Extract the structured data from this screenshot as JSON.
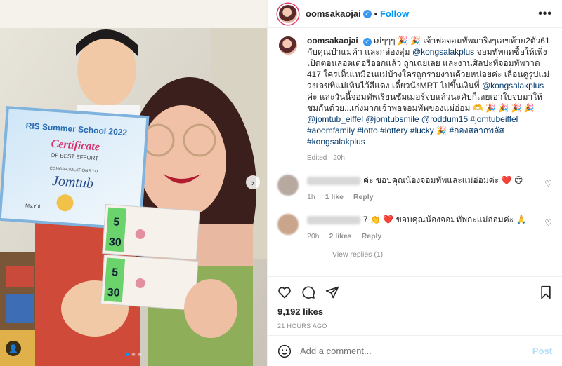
{
  "post": {
    "username": "oomsakaojai",
    "follow_label": "Follow",
    "separator": "•",
    "more_label": "•••"
  },
  "media": {
    "certificate_title": "RIS Summer School 2022",
    "certificate_heading": "Certificate",
    "certificate_sub": "OF BEST EFFORT",
    "congrats": "CONGRATULATIONS TO",
    "recipient": "Jomtub",
    "signature": "Ms.Yui",
    "ticket_numbers": [
      "5",
      "30"
    ],
    "ticket_numbers_2": [
      "5",
      "30"
    ],
    "slide_count": 3,
    "active_slide": 1
  },
  "caption": {
    "username": "oomsakaojai",
    "part1": "เย่ๆๆๆ 🎉 🎉 เจ้าพ่อจอมทัพมาริงๆเลขท้าย2ตัว61 กับคุณป๋าแม่ค้า และกล่องสุ่ม",
    "mention1": "@kongsalakplus",
    "part2": "จอมทัพกดซื้อให้เพิ่ง เปิดตอนลอตเตอรี่ออกแล้ว ถูกเฉยเลย และงานศิลปะที่จอมทัพวาด 417 ใครเห็นเหมือนแม่บ้างใครถูกรายงานด้วยหน่อยค่ะ เลื่อนดูรูปแม่วงเลขที่แม่เห็นไว้สีแดง เดี๋ยวนั่งMRT ไปขึ้นเงินที่",
    "mention2": "@kongsalakplus",
    "part3": "ค่ะ และวันนี้จอมทัพเรียนซัมเมอร์จบแล้วนะคับก็เลยเอาใบจบมาให้ชมกันด้วย...เก่งมากเจ้าพ่อจอมทัพของแม่อ่อม 🫶 🎉 🎉 🎉 🎉",
    "mention3": "@jomtub_eiffel",
    "mention4": "@jomtubsmile",
    "mention5": "@roddum15",
    "mention6": "#jomtubeiffel",
    "mention7": "#aoomfamily",
    "mention8": "#lotto",
    "mention9": "#lottery",
    "mention10": "#lucky",
    "emoji_end": "🎉",
    "mention11": "#กองสลากพลัส",
    "mention12": "#kongsalakplus",
    "edited": "Edited · 20h"
  },
  "comments": [
    {
      "text": "ค่ะ ขอบคุณน้องจอมทัพและแม่อ่อมค่ะ ❤️ 😍",
      "time": "1h",
      "likes": "1 like",
      "reply": "Reply"
    },
    {
      "prefix": "7",
      "text": "👏 ❤️ ขอบคุณน้องจอมทัพกะแม่อ่อมค่ะ 🙏",
      "time": "20h",
      "likes": "2 likes",
      "reply": "Reply"
    }
  ],
  "view_replies": "View replies (1)",
  "likes": "9,192 likes",
  "timestamp": "21 HOURS AGO",
  "add_comment": {
    "placeholder": "Add a comment...",
    "post_label": "Post"
  },
  "colors": {
    "accent": "#0095f6",
    "link": "#00376b",
    "muted": "#8e8e8e",
    "post_disabled": "#b2dffc"
  }
}
